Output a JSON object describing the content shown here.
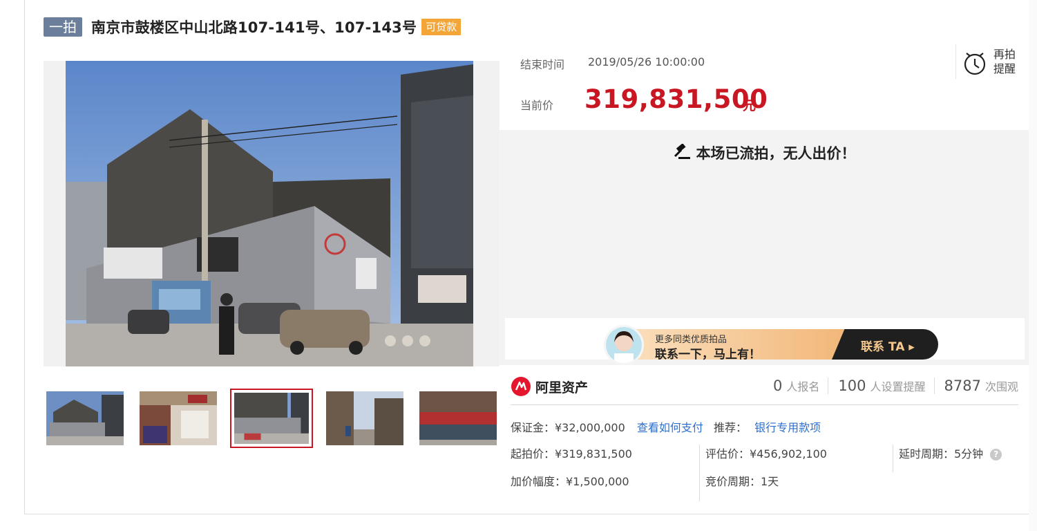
{
  "header": {
    "round_badge": "一拍",
    "title": "南京市鼓楼区中山北路107-141号、107-143号",
    "loan_badge": "可贷款"
  },
  "auction": {
    "end_time_label": "结束时间",
    "end_time": "2019/05/26 10:00:00",
    "price_label": "当前价",
    "price": "319,831,500",
    "price_unit": "元",
    "remind_label": "再拍提醒",
    "status": "本场已流拍，无人出价！"
  },
  "promo": {
    "small_text": "更多同类优质拍品",
    "big_text": "联系一下，马上有！",
    "button_label": "联系 TA ▸"
  },
  "brand": {
    "name": "阿里资产"
  },
  "stats": [
    {
      "num": "0",
      "label": "人报名"
    },
    {
      "num": "100",
      "label": "人设置提醒"
    },
    {
      "num": "8787",
      "label": "次围观"
    }
  ],
  "details": {
    "deposit": "保证金：¥32,000,000",
    "pay_link": "查看如何支付",
    "recommend_label": "推荐：",
    "recommend_link": "银行专用款项",
    "start_price": "起拍价：¥319,831,500",
    "increment": "加价幅度：¥1,500,000",
    "appraisal": "评估价：¥456,902,100",
    "bid_cycle": "竞价周期：1天",
    "delay_cycle": "延时周期：5分钟",
    "help_glyph": "?"
  },
  "gallery": {
    "active_index": 2,
    "thumbnails": [
      "thumb-building-front",
      "thumb-store-interior",
      "thumb-building-side",
      "thumb-old-street",
      "thumb-shop-row"
    ]
  },
  "colors": {
    "price_red": "#c81623",
    "badge_blue": "#6b7f9c",
    "loan_orange": "#f3a537",
    "link_blue": "#2d6fcd"
  }
}
